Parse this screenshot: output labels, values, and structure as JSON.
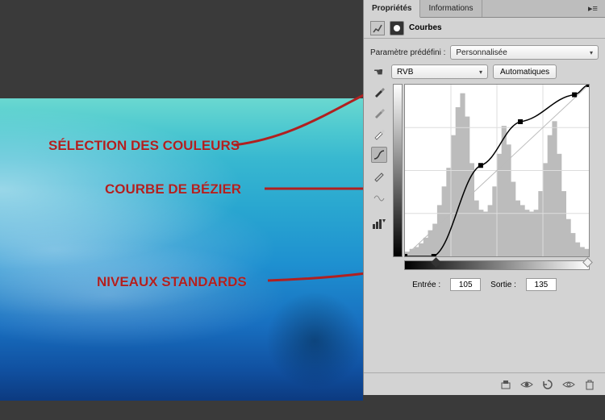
{
  "tabs": {
    "properties": "Propriétés",
    "information": "Informations"
  },
  "header": {
    "title": "Courbes"
  },
  "preset": {
    "label": "Paramètre prédéfini :",
    "value": "Personnalisée"
  },
  "channel": {
    "value": "RVB",
    "auto": "Automatiques"
  },
  "io": {
    "inLabel": "Entrée :",
    "inVal": "105",
    "outLabel": "Sortie :",
    "outVal": "135"
  },
  "annotations": {
    "colors": "SÉLECTION DES COULEURS",
    "bezier": "COURBE DE BÉZIER",
    "levels": "NIVEAUX STANDARDS"
  },
  "icons": {
    "adjust": "adjustments-icon",
    "mask": "mask-icon"
  },
  "chart_data": {
    "type": "line",
    "title": "",
    "xlabel": "Entrée",
    "ylabel": "Sortie",
    "xlim": [
      0,
      255
    ],
    "ylim": [
      0,
      255
    ],
    "grid": "4x4",
    "baseline_diagonal": true,
    "black_point_slider": 40,
    "white_point_slider": 255,
    "series": [
      {
        "name": "RVB curve",
        "points": [
          {
            "x": 0,
            "y": 0
          },
          {
            "x": 40,
            "y": 0
          },
          {
            "x": 105,
            "y": 135
          },
          {
            "x": 160,
            "y": 200
          },
          {
            "x": 235,
            "y": 240
          },
          {
            "x": 255,
            "y": 255
          }
        ]
      }
    ],
    "histogram_approx": [
      5,
      8,
      10,
      14,
      20,
      28,
      35,
      55,
      75,
      95,
      130,
      160,
      175,
      150,
      100,
      60,
      50,
      48,
      55,
      75,
      110,
      140,
      120,
      80,
      60,
      55,
      50,
      48,
      50,
      70,
      100,
      130,
      145,
      110,
      70,
      40,
      25,
      15,
      10,
      8
    ]
  }
}
